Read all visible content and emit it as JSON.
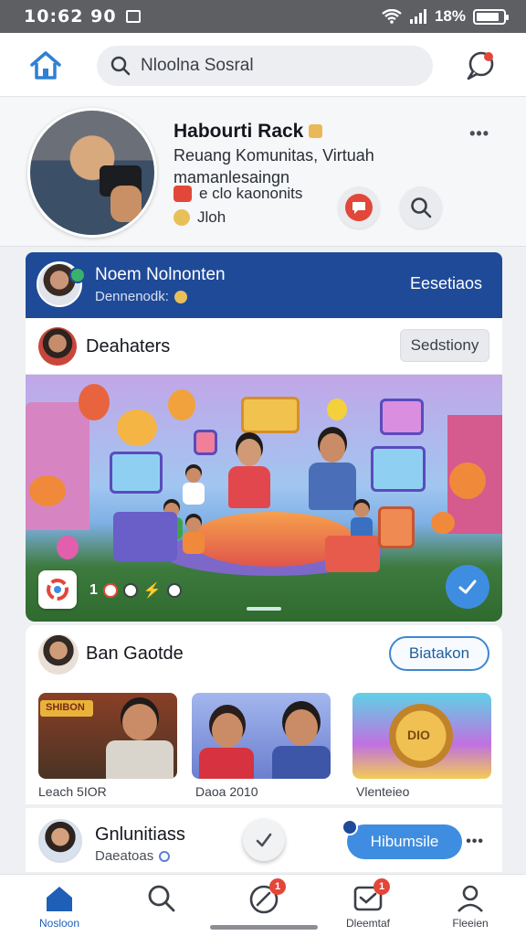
{
  "status_bar": {
    "time": "10:62 90",
    "battery": "18%"
  },
  "header": {
    "search_placeholder": "Nloolna Sosral"
  },
  "profile": {
    "name": "Habourti Rack",
    "description": "Reuang Komunitas, Virtuah mamanlesaingn",
    "tag": "e clo kaononits",
    "tag2": "Jloh",
    "more": "•••"
  },
  "community": {
    "title": "Noem Nolnonten",
    "subtitle": "Dennenodk:",
    "action": "Eesetiaos"
  },
  "channel": {
    "label": "Deahaters",
    "button": "Sedstiony"
  },
  "hero": {
    "reaction_count": "1"
  },
  "section": {
    "title": "Ban Gaotde",
    "button": "Biatakon",
    "thumbnails": [
      {
        "caption": "Leach 5IOR",
        "sign": "SHIBON"
      },
      {
        "caption": "Daoa 2010"
      },
      {
        "caption": "Vlenteieo",
        "coin_text": "DIO"
      }
    ]
  },
  "group": {
    "title": "Gnlunitiass",
    "subtitle": "Daeatoas",
    "button": "Hibumsile",
    "more": "•••"
  },
  "nav": {
    "items": [
      {
        "label": "Nosloon"
      },
      {
        "label": ""
      },
      {
        "label": "",
        "badge": "1"
      },
      {
        "label": "Dleemtaf",
        "badge": "1"
      },
      {
        "label": "Fleeien"
      }
    ]
  },
  "colors": {
    "primary": "#1f4a98",
    "accent": "#3f8de0",
    "alert": "#e2473a"
  }
}
